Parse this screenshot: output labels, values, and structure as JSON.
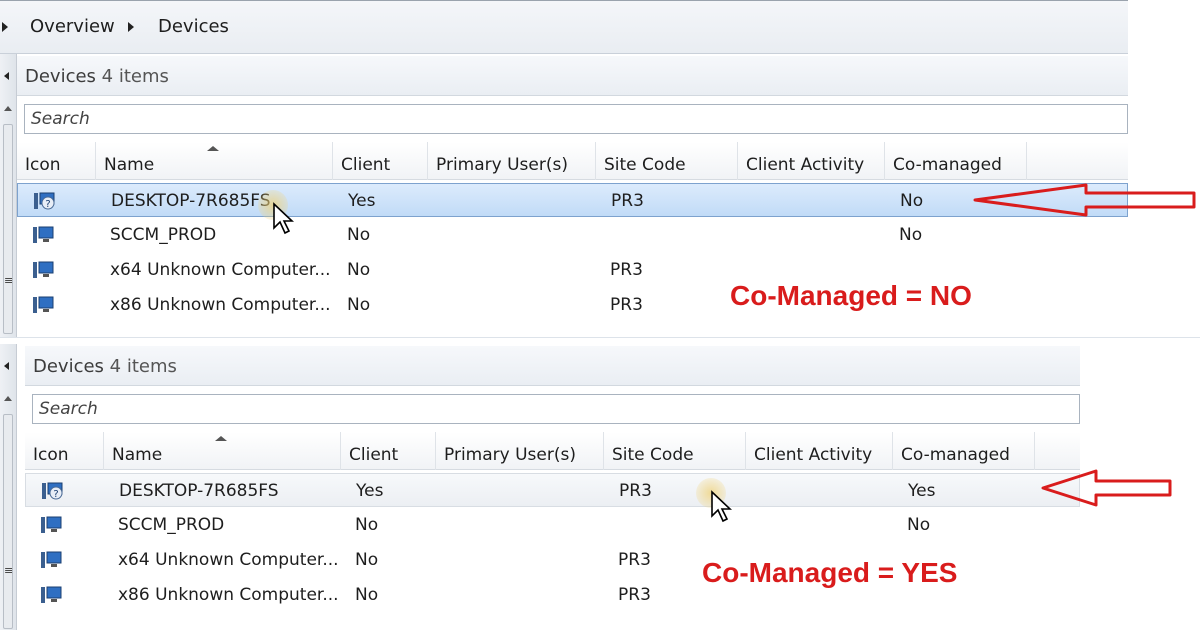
{
  "breadcrumb": {
    "items": [
      "Overview",
      "Devices"
    ]
  },
  "icons": {
    "breadcrumb_separator": "breadcrumb-arrow-icon",
    "device": "computer-device-icon",
    "device_unknown": "computer-question-icon",
    "cursor": "mouse-pointer-icon"
  },
  "panels": [
    {
      "header": {
        "title": "Devices",
        "count": "4 items"
      },
      "search": {
        "placeholder": "Search"
      },
      "columns": [
        "Icon",
        "Name",
        "Client",
        "Primary User(s)",
        "Site Code",
        "Client Activity",
        "Co-managed"
      ],
      "rows": [
        {
          "name": "DESKTOP-7R685FS",
          "client": "Yes",
          "primary_users": "",
          "site_code": "PR3",
          "client_activity": "",
          "co_managed": "No",
          "state": "selected"
        },
        {
          "name": "SCCM_PROD",
          "client": "No",
          "primary_users": "",
          "site_code": "",
          "client_activity": "",
          "co_managed": "No",
          "state": "normal"
        },
        {
          "name": "x64 Unknown Computer...",
          "client": "No",
          "primary_users": "",
          "site_code": "PR3",
          "client_activity": "",
          "co_managed": "",
          "state": "normal"
        },
        {
          "name": "x86 Unknown Computer...",
          "client": "No",
          "primary_users": "",
          "site_code": "PR3",
          "client_activity": "",
          "co_managed": "",
          "state": "normal"
        }
      ],
      "annotation": "Co-Managed = NO"
    },
    {
      "header": {
        "title": "Devices",
        "count": "4 items"
      },
      "search": {
        "placeholder": "Search"
      },
      "columns": [
        "Icon",
        "Name",
        "Client",
        "Primary User(s)",
        "Site Code",
        "Client Activity",
        "Co-managed"
      ],
      "rows": [
        {
          "name": "DESKTOP-7R685FS",
          "client": "Yes",
          "primary_users": "",
          "site_code": "PR3",
          "client_activity": "",
          "co_managed": "Yes",
          "state": "hover"
        },
        {
          "name": "SCCM_PROD",
          "client": "No",
          "primary_users": "",
          "site_code": "",
          "client_activity": "",
          "co_managed": "No",
          "state": "normal"
        },
        {
          "name": "x64 Unknown Computer...",
          "client": "No",
          "primary_users": "",
          "site_code": "PR3",
          "client_activity": "",
          "co_managed": "",
          "state": "normal"
        },
        {
          "name": "x86 Unknown Computer...",
          "client": "No",
          "primary_users": "",
          "site_code": "PR3",
          "client_activity": "",
          "co_managed": "",
          "state": "normal"
        }
      ],
      "annotation": "Co-Managed = YES"
    }
  ],
  "colors": {
    "annotation_red": "#d91c1c",
    "selection_blue": "#c1dbf7",
    "selection_border": "#7da2ce"
  }
}
